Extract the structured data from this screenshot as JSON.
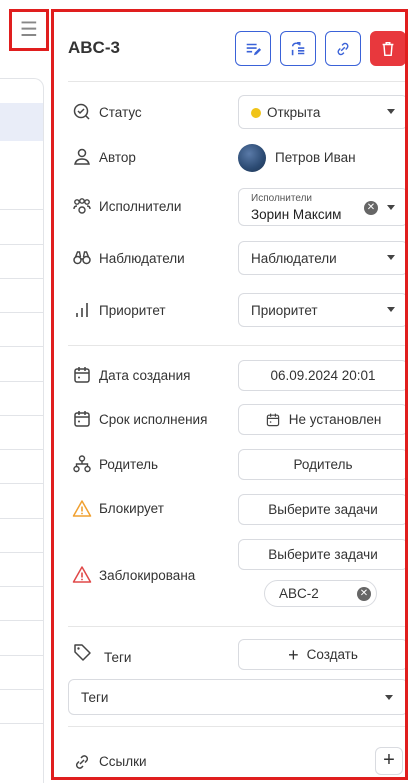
{
  "menu_icon": "hamburger-icon",
  "task": {
    "title": "ABC-3",
    "toolbar": {
      "edit_icon": "edit-list-icon",
      "move_icon": "move-task-icon",
      "link_icon": "link-icon",
      "delete_icon": "trash-icon"
    }
  },
  "fields": {
    "status": {
      "label": "Статус",
      "value": "Открыта",
      "dot_color": "#f0c419",
      "icon": "status-check-icon"
    },
    "author": {
      "label": "Автор",
      "value": "Петров Иван",
      "icon": "user-icon"
    },
    "assignees": {
      "label": "Исполнители",
      "field_caption": "Исполнители",
      "value": "Зорин Максим",
      "icon": "group-icon"
    },
    "watchers": {
      "label": "Наблюдатели",
      "placeholder": "Наблюдатели",
      "icon": "binoculars-icon"
    },
    "priority": {
      "label": "Приоритет",
      "placeholder": "Приоритет",
      "icon": "bar-chart-icon"
    },
    "created": {
      "label": "Дата создания",
      "value": "06.09.2024 20:01",
      "icon": "calendar-icon"
    },
    "due": {
      "label": "Срок исполнения",
      "value": "Не установлен",
      "icon": "calendar-icon"
    },
    "parent": {
      "label": "Родитель",
      "value": "Родитель",
      "icon": "hierarchy-icon"
    },
    "blocks": {
      "label": "Блокирует",
      "value": "Выберите задачи",
      "icon": "warning-icon",
      "icon_color": "#f0a030"
    },
    "blocked_by": {
      "label": "Заблокирована",
      "value": "Выберите задачи",
      "chip": "ABC-2",
      "icon": "warning-icon",
      "icon_color": "#e04848"
    },
    "tags": {
      "label": "Теги",
      "create_label": "Создать",
      "placeholder": "Теги",
      "icon": "tag-icon"
    },
    "links": {
      "label": "Ссылки",
      "icon": "link-icon"
    }
  },
  "colors": {
    "accent": "#3a62d8",
    "danger": "#e8383d",
    "highlight_border": "#e01e1e"
  }
}
